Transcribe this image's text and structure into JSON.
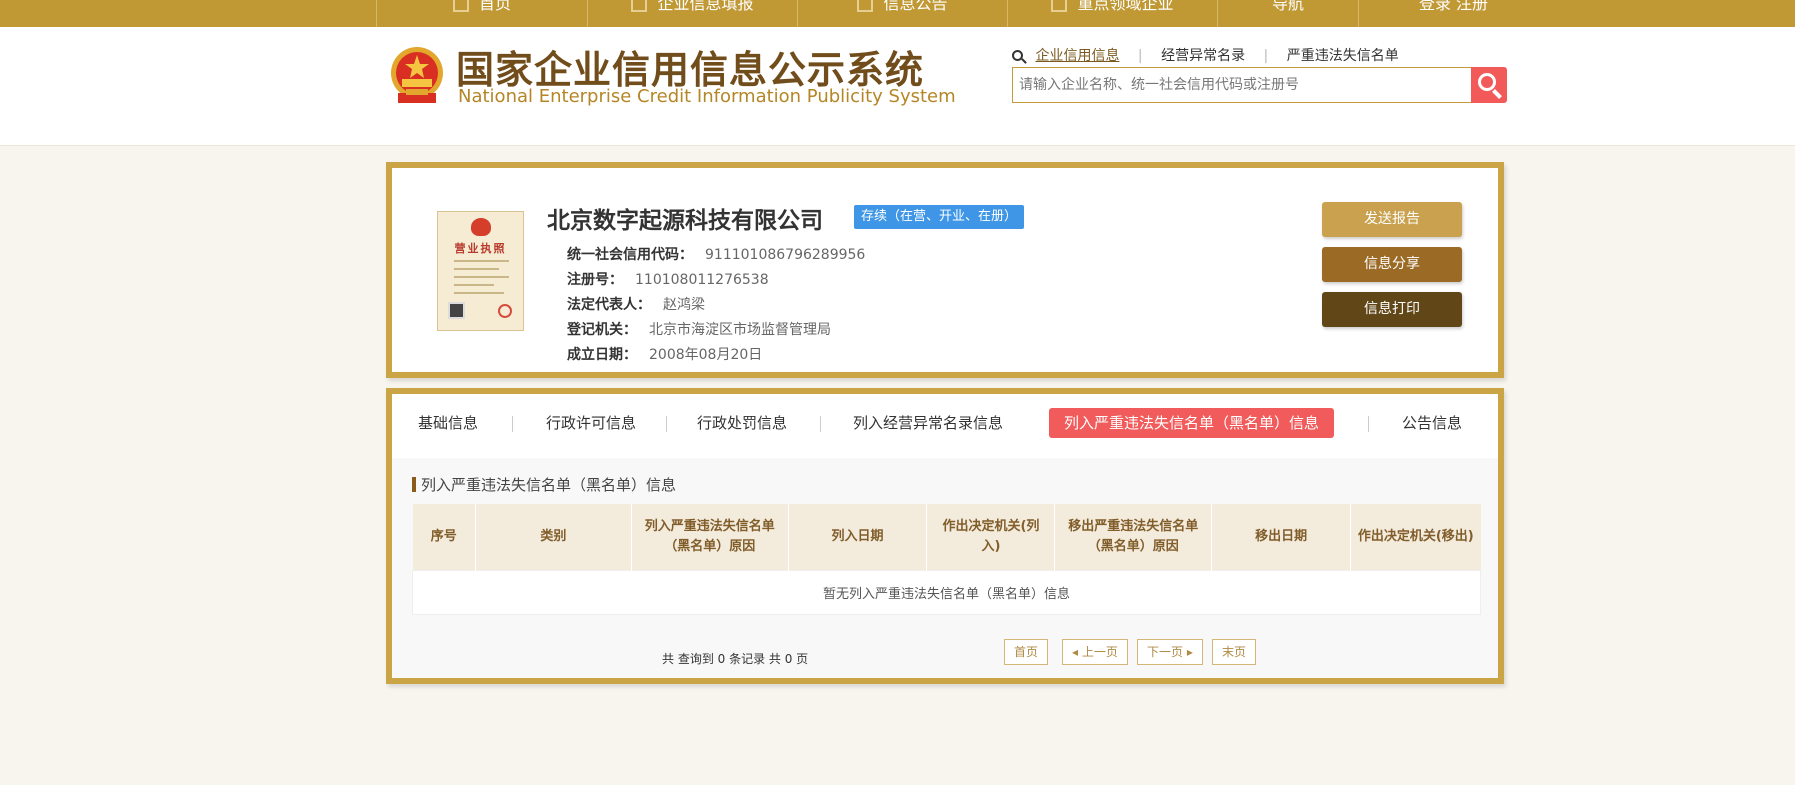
{
  "topnav": {
    "items": [
      {
        "label": "首页",
        "icon": "home-icon"
      },
      {
        "label": "企业信息填报",
        "icon": "edit-icon"
      },
      {
        "label": "信息公告",
        "icon": "notice-icon"
      },
      {
        "label": "重点领域企业",
        "icon": "speaker-icon"
      },
      {
        "label": "导航"
      },
      {
        "label": "登录  注册"
      }
    ]
  },
  "header": {
    "title_cn": "国家企业信用信息公示系统",
    "title_en": "National Enterprise Credit Information Publicity System"
  },
  "search": {
    "tabs": [
      "企业信用信息",
      "经营异常名录",
      "严重违法失信名单"
    ],
    "active_tab": "企业信用信息",
    "placeholder": "请输入企业名称、统一社会信用代码或注册号"
  },
  "company": {
    "name": "北京数字起源科技有限公司",
    "status": "存续（在营、开业、在册）",
    "fields": [
      {
        "label": "统一社会信用代码：",
        "value": "911101086796289956"
      },
      {
        "label": "注册号：",
        "value": "110108011276538"
      },
      {
        "label": "法定代表人：",
        "value": "赵鸿梁"
      },
      {
        "label": "登记机关：",
        "value": "北京市海淀区市场监督管理局"
      },
      {
        "label": "成立日期：",
        "value": "2008年08月20日"
      }
    ],
    "license_title": "营业执照"
  },
  "actions": {
    "send_report": "发送报告",
    "share": "信息分享",
    "print": "信息打印"
  },
  "tabs": {
    "items": [
      "基础信息",
      "行政许可信息",
      "行政处罚信息",
      "列入经营异常名录信息",
      "列入严重违法失信名单（黑名单）信息",
      "公告信息"
    ],
    "active": "列入严重违法失信名单（黑名单）信息"
  },
  "section": {
    "title": "列入严重违法失信名单（黑名单）信息",
    "columns": [
      "序号",
      "类别",
      "列入严重违法失信名单（黑名单）原因",
      "列入日期",
      "作出决定机关(列入)",
      "移出严重违法失信名单（黑名单）原因",
      "移出日期",
      "作出决定机关(移出)"
    ],
    "empty_text": "暂无列入严重违法失信名单（黑名单）信息"
  },
  "pagination": {
    "total_text": "共 查询到 0 条记录 共 0 页",
    "first": "首页",
    "prev": "◂ 上一页",
    "next": "下一页 ▸",
    "last": "末页"
  },
  "colors": {
    "accent_gold": "#c09834",
    "active_red": "#f25a5a",
    "status_blue": "#3f96e6"
  }
}
